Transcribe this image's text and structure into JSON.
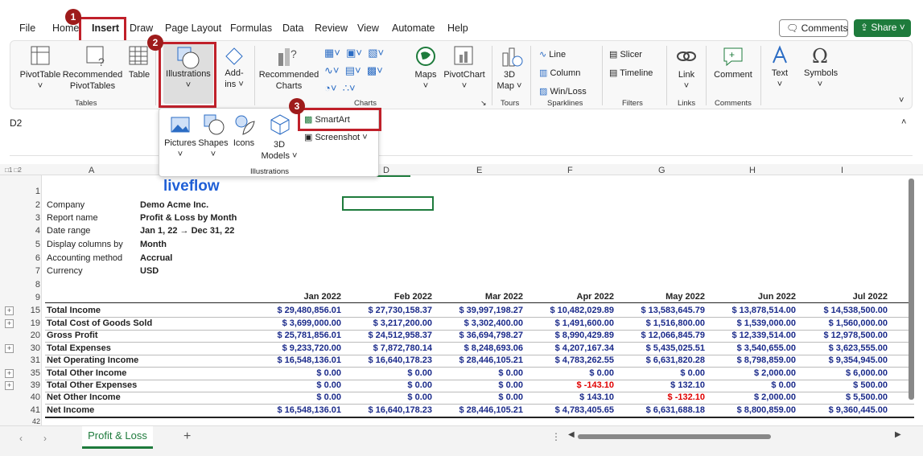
{
  "menu": {
    "tabs": [
      "File",
      "Home",
      "Insert",
      "Draw",
      "Page Layout",
      "Formulas",
      "Data",
      "Review",
      "View",
      "Automate",
      "Help"
    ],
    "comments": "Comments",
    "share": "Share"
  },
  "ribbon": {
    "pivot": "PivotTable",
    "recpivot1": "Recommended",
    "recpivot2": "PivotTables",
    "table": "Table",
    "tables_group": "Tables",
    "illustrations": "Illustrations",
    "addins1": "Add-",
    "addins2": "ins",
    "recchart1": "Recommended",
    "recchart2": "Charts",
    "maps": "Maps",
    "pivotchart": "PivotChart",
    "charts_group": "Charts",
    "map3d1": "3D",
    "map3d2": "Map",
    "tours_group": "Tours",
    "line": "Line",
    "column": "Column",
    "winloss": "Win/Loss",
    "sparklines_group": "Sparklines",
    "slicer": "Slicer",
    "timeline": "Timeline",
    "filters_group": "Filters",
    "link": "Link",
    "links_group": "Links",
    "comment": "Comment",
    "comments_group": "Comments",
    "text": "Text",
    "symbols": "Symbols"
  },
  "popup": {
    "pictures": "Pictures",
    "shapes": "Shapes",
    "icons": "Icons",
    "models1": "3D",
    "models2": "Models",
    "smartart": "SmartArt",
    "screenshot": "Screenshot",
    "group": "Illustrations"
  },
  "badges": [
    "1",
    "2",
    "3"
  ],
  "namebox": "D2",
  "columns": [
    "A",
    "D",
    "E",
    "F",
    "G",
    "H",
    "I"
  ],
  "logo": "liveflow",
  "meta": [
    {
      "row": "2",
      "label": "Company",
      "value": "Demo Acme Inc."
    },
    {
      "row": "3",
      "label": "Report name",
      "value": "Profit & Loss by Month"
    },
    {
      "row": "4",
      "label": "Date range",
      "value": "Jan 1, 22 → Dec 31, 22"
    },
    {
      "row": "5",
      "label": "Display columns by",
      "value": "Month"
    },
    {
      "row": "6",
      "label": "Accounting method",
      "value": "Accrual"
    },
    {
      "row": "7",
      "label": "Currency",
      "value": "USD"
    }
  ],
  "months": [
    "Jan 2022",
    "Feb 2022",
    "Mar 2022",
    "Apr 2022",
    "May 2022",
    "Jun 2022",
    "Jul 2022"
  ],
  "rows": [
    {
      "num": "15",
      "label": "Total Income",
      "vals": [
        "$ 29,480,856.01",
        "$ 27,730,158.37",
        "$ 39,997,198.27",
        "$ 10,482,029.89",
        "$ 13,583,645.79",
        "$ 13,878,514.00",
        "$ 14,538,500.00"
      ]
    },
    {
      "num": "19",
      "label": "Total Cost of Goods Sold",
      "vals": [
        "$ 3,699,000.00",
        "$ 3,217,200.00",
        "$ 3,302,400.00",
        "$ 1,491,600.00",
        "$ 1,516,800.00",
        "$ 1,539,000.00",
        "$ 1,560,000.00"
      ]
    },
    {
      "num": "20",
      "label": "Gross Profit",
      "vals": [
        "$ 25,781,856.01",
        "$ 24,512,958.37",
        "$ 36,694,798.27",
        "$ 8,990,429.89",
        "$ 12,066,845.79",
        "$ 12,339,514.00",
        "$ 12,978,500.00"
      ]
    },
    {
      "num": "30",
      "label": "Total Expenses",
      "vals": [
        "$ 9,233,720.00",
        "$ 7,872,780.14",
        "$ 8,248,693.06",
        "$ 4,207,167.34",
        "$ 5,435,025.51",
        "$ 3,540,655.00",
        "$ 3,623,555.00"
      ]
    },
    {
      "num": "31",
      "label": "Net Operating Income",
      "vals": [
        "$ 16,548,136.01",
        "$ 16,640,178.23",
        "$ 28,446,105.21",
        "$ 4,783,262.55",
        "$ 6,631,820.28",
        "$ 8,798,859.00",
        "$ 9,354,945.00"
      ]
    },
    {
      "num": "35",
      "label": "Total Other Income",
      "vals": [
        "$ 0.00",
        "$ 0.00",
        "$ 0.00",
        "$ 0.00",
        "$ 0.00",
        "$ 2,000.00",
        "$ 6,000.00"
      ]
    },
    {
      "num": "39",
      "label": "Total Other Expenses",
      "vals": [
        "$ 0.00",
        "$ 0.00",
        "$ 0.00",
        "$ -143.10",
        "$ 132.10",
        "$ 0.00",
        "$ 500.00"
      ]
    },
    {
      "num": "40",
      "label": "Net Other Income",
      "vals": [
        "$ 0.00",
        "$ 0.00",
        "$ 0.00",
        "$ 143.10",
        "$ -132.10",
        "$ 2,000.00",
        "$ 5,500.00"
      ]
    },
    {
      "num": "41",
      "label": "Net Income",
      "vals": [
        "$ 16,548,136.01",
        "$ 16,640,178.23",
        "$ 28,446,105.21",
        "$ 4,783,405.65",
        "$ 6,631,688.18",
        "$ 8,800,859.00",
        "$ 9,360,445.00"
      ]
    }
  ],
  "sheet_tab": "Profit & Loss",
  "colors": {
    "navy": "#1a2a8a",
    "red": "#e00000",
    "green": "#1e7b3c",
    "accent": "#c0202a"
  }
}
